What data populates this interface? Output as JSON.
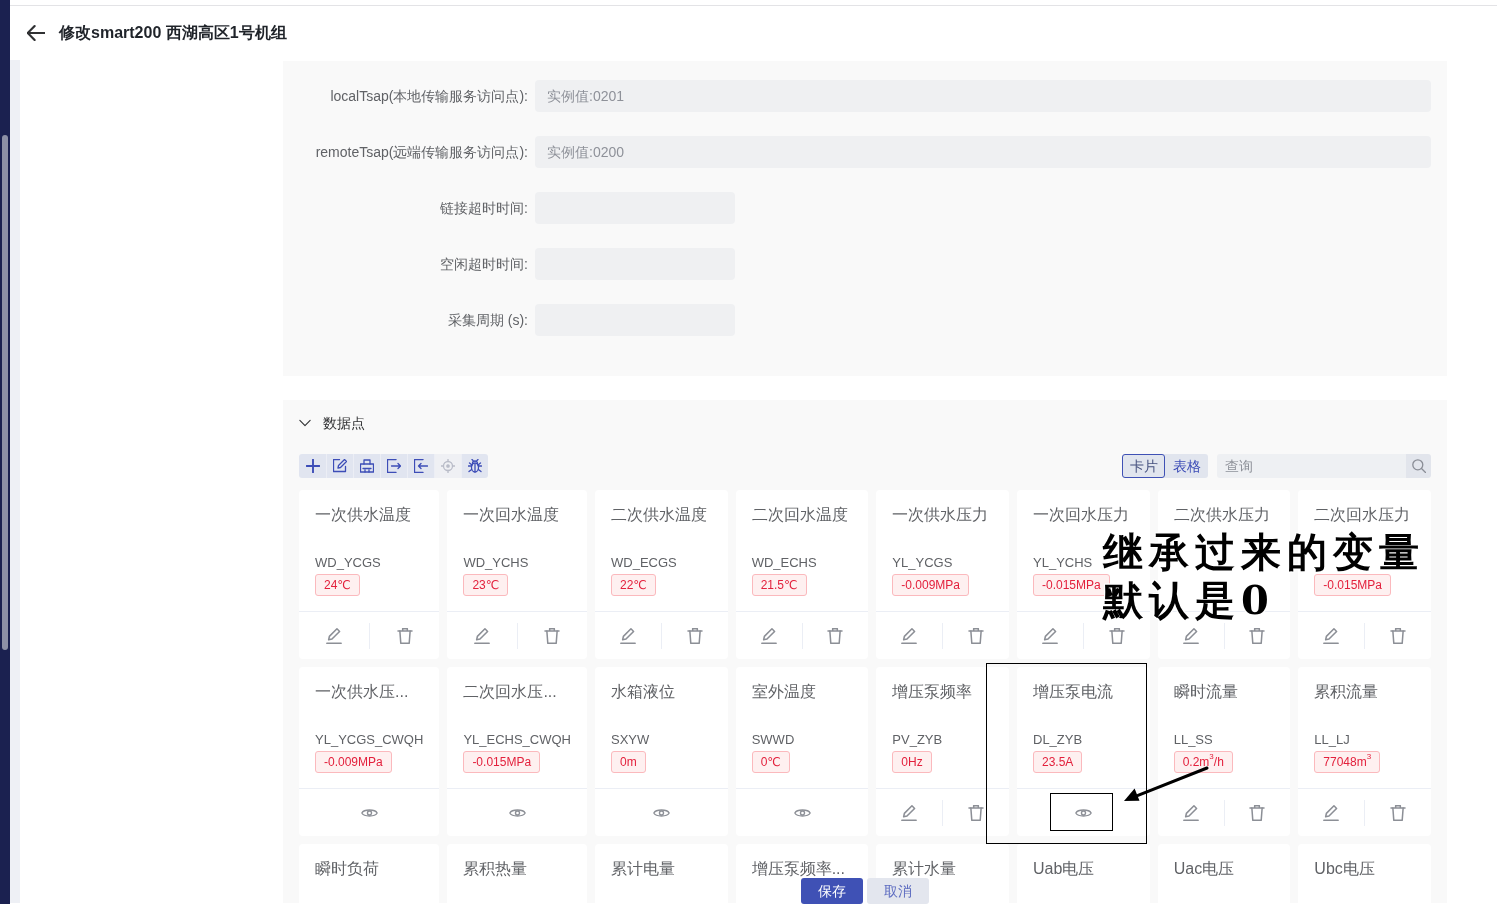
{
  "header": {
    "title": "修改smart200 西湖高区1号机组"
  },
  "form": {
    "fields": [
      {
        "label": "localTsap(本地传输服务访问点):",
        "placeholder": "实例值:0201",
        "kind": "wide"
      },
      {
        "label": "remoteTsap(远端传输服务访问点):",
        "placeholder": "实例值:0200",
        "kind": "wide"
      },
      {
        "label": "链接超时时间:",
        "kind": "short"
      },
      {
        "label": "空闲超时时间:",
        "kind": "short"
      },
      {
        "label": "采集周期 (s):",
        "kind": "short"
      }
    ]
  },
  "data_points": {
    "title": "数据点",
    "expanded": true,
    "toolbar": [
      {
        "kind": "add",
        "disabled": false
      },
      {
        "kind": "edit",
        "disabled": false
      },
      {
        "kind": "print",
        "disabled": false
      },
      {
        "kind": "export",
        "disabled": false
      },
      {
        "kind": "import",
        "disabled": false
      },
      {
        "kind": "locate",
        "disabled": true
      },
      {
        "kind": "debug",
        "disabled": false
      }
    ],
    "view_switch": [
      {
        "label": "卡片",
        "selected": true
      },
      {
        "label": "表格",
        "selected": false
      }
    ],
    "search": {
      "placeholder": "查询"
    },
    "cards": [
      {
        "title": "一次供水温度",
        "code": "WD_YCGS",
        "value": "24℃",
        "readonly": false
      },
      {
        "title": "一次回水温度",
        "code": "WD_YCHS",
        "value": "23℃",
        "readonly": false
      },
      {
        "title": "二次供水温度",
        "code": "WD_ECGS",
        "value": "22℃",
        "readonly": false
      },
      {
        "title": "二次回水温度",
        "code": "WD_ECHS",
        "value": "21.5℃",
        "readonly": false
      },
      {
        "title": "一次供水压力",
        "code": "YL_YCGS",
        "value": "-0.009MPa",
        "readonly": false
      },
      {
        "title": "一次回水压力",
        "code": "YL_YCHS",
        "value": "-0.015MPa",
        "readonly": false
      },
      {
        "title": "二次供水压力",
        "readonly": false
      },
      {
        "title": "二次回水压力",
        "value": "-0.015MPa",
        "readonly": false
      },
      {
        "title": "一次供水压...",
        "code": "YL_YCGS_CWQH",
        "value": "-0.009MPa",
        "readonly": true
      },
      {
        "title": "二次回水压...",
        "code": "YL_ECHS_CWQH",
        "value": "-0.015MPa",
        "readonly": true
      },
      {
        "title": "水箱液位",
        "code": "SXYW",
        "value": "0m",
        "readonly": true
      },
      {
        "title": "室外温度",
        "code": "SWWD",
        "value": "0℃",
        "readonly": true
      },
      {
        "title": "增压泵频率",
        "code": "PV_ZYB",
        "value": "0Hz",
        "readonly": false
      },
      {
        "title": "增压泵电流",
        "code": "DL_ZYB",
        "value": "23.5A",
        "readonly": true
      },
      {
        "title": "瞬时流量",
        "code": "LL_SS",
        "value": "0.2m$^{3}$/h",
        "readonly": false
      },
      {
        "title": "累积流量",
        "code": "LL_LJ",
        "value": "77048m$^{3}$",
        "readonly": false
      },
      {
        "title": "瞬时负荷"
      },
      {
        "title": "累积热量"
      },
      {
        "title": "累计电量"
      },
      {
        "title": "增压泵频率..."
      },
      {
        "title": "累计水量"
      },
      {
        "title": "Uab电压"
      },
      {
        "title": "Uac电压"
      },
      {
        "title": "Ubc电压"
      }
    ]
  },
  "footer_buttons": [
    {
      "label": "保存",
      "kind": "primary"
    },
    {
      "label": "取消",
      "kind": "secondary"
    }
  ],
  "annotation": {
    "lines": [
      "继承过来的变量",
      "默认是0"
    ]
  }
}
